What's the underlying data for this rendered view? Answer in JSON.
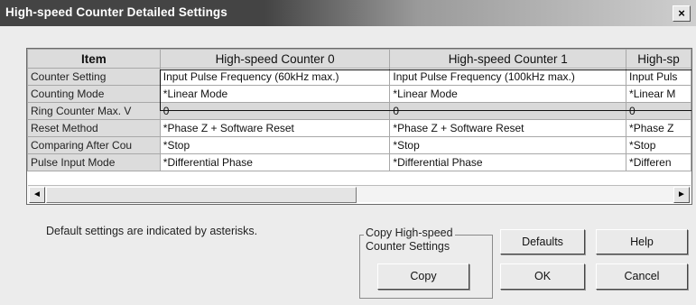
{
  "window": {
    "title": "High-speed Counter Detailed Settings",
    "close_label": "×"
  },
  "table": {
    "headers": [
      "Item",
      "High-speed Counter 0",
      "High-speed Counter 1",
      "High-sp"
    ],
    "rows": [
      [
        "Counter Setting",
        "Input Pulse Frequency (60kHz max.)",
        "Input Pulse Frequency (100kHz max.)",
        "Input Puls"
      ],
      [
        "Counting Mode",
        "*Linear Mode",
        "*Linear Mode",
        "*Linear M"
      ],
      [
        "Ring Counter Max. V",
        "0",
        "0",
        "0"
      ],
      [
        "Reset Method",
        "*Phase Z + Software Reset",
        "*Phase Z + Software Reset",
        "*Phase Z"
      ],
      [
        "Comparing After Cou",
        "*Stop",
        "*Stop",
        "*Stop"
      ],
      [
        "Pulse Input Mode",
        "*Differential Phase",
        "*Differential Phase",
        "*Differen"
      ]
    ]
  },
  "scrollbar": {
    "left_arrow": "◄",
    "right_arrow": "►"
  },
  "note": "Default settings are indicated by asterisks.",
  "copy_group": {
    "label_line1": "Copy High-speed",
    "label_line2": "Counter Settings",
    "copy_label": "Copy"
  },
  "buttons": {
    "defaults": "Defaults",
    "help": "Help",
    "ok": "OK",
    "cancel": "Cancel"
  }
}
